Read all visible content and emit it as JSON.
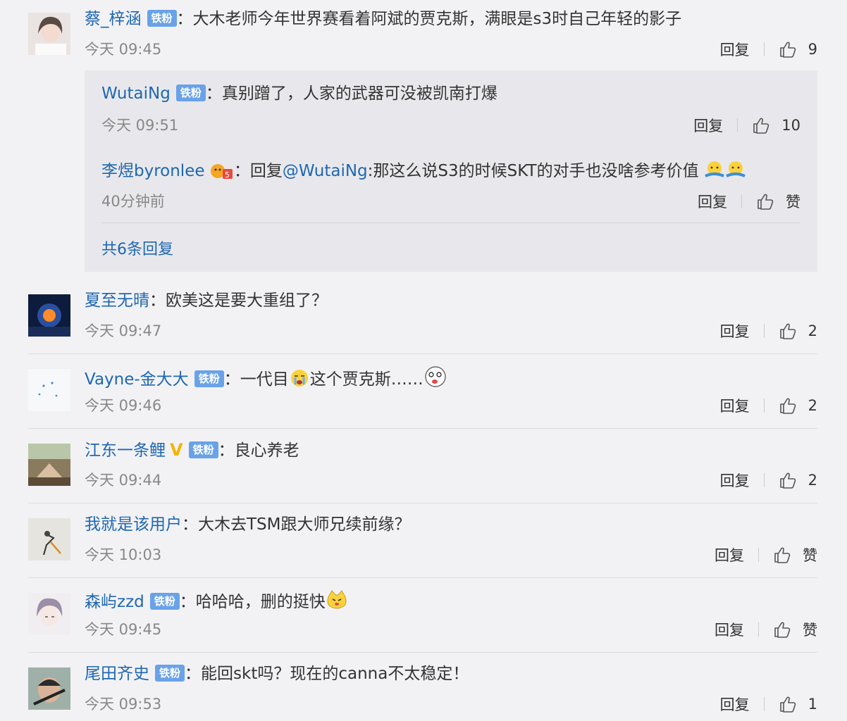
{
  "badge_label": "铁粉",
  "reply_label": "回复",
  "like_icon": "thumbs-up-icon",
  "comments": [
    {
      "user": "蔡_梓涵",
      "text": "大木老师今年世界赛看着阿斌的贾克斯，满眼是s3时自己年轻的影子",
      "time": "今天 09:45",
      "likes": "9",
      "replies": [
        {
          "user": "WutaiNg",
          "text": "真别蹭了，人家的武器可没被凯南打爆",
          "time": "今天 09:51",
          "likes": "10"
        },
        {
          "user": "李煜byronlee",
          "text": "回复",
          "mention": "@WutaiNg",
          "text2": ":那这么说S3的时候SKT的对手也没啥参考价值",
          "time": "40分钟前",
          "likes": "赞"
        }
      ],
      "more_replies": "共6条回复"
    },
    {
      "user": "夏至无晴",
      "text": "欧美这是要大重组了？",
      "time": "今天 09:47",
      "likes": "2"
    },
    {
      "user": "Vayne-金大大",
      "text_a": "一代目",
      "text_b": "这个贾克斯……",
      "time": "今天 09:46",
      "likes": "2"
    },
    {
      "user": "江东一条鲤",
      "text": "良心养老",
      "time": "今天 09:44",
      "likes": "2"
    },
    {
      "user": "我就是该用户",
      "text": "大木去TSM跟大师兄续前缘？",
      "time": "今天 10:03",
      "likes": "赞"
    },
    {
      "user": "森屿zzd",
      "text": "哈哈哈，删的挺快",
      "time": "今天 09:45",
      "likes": "赞"
    },
    {
      "user": "尾田齐史",
      "text": "能回skt吗？现在的canna不太稳定！",
      "time": "今天 09:53",
      "likes": "1"
    }
  ]
}
